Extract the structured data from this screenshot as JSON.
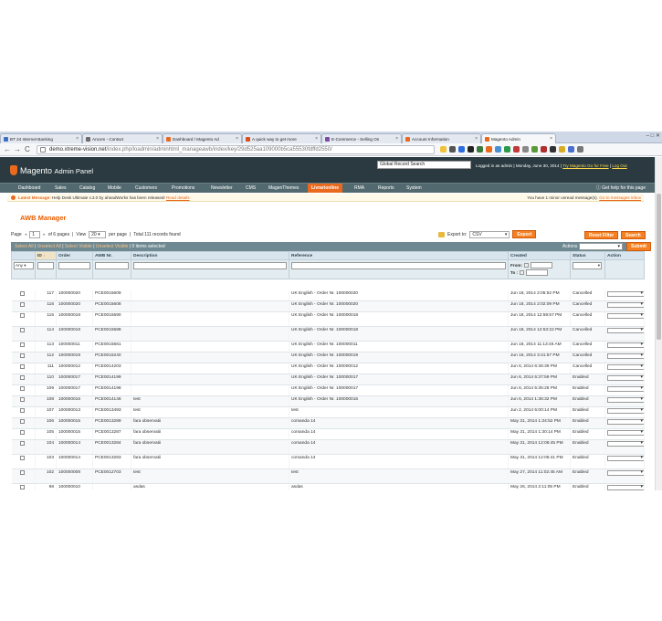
{
  "browser": {
    "tabs": [
      {
        "title": "BT 24 Internet Banking",
        "color": "#3a6fc4"
      },
      {
        "title": "Ancom - Contact",
        "color": "#6c6c6c"
      },
      {
        "title": "Dashboard / Magento Ad",
        "color": "#e96a1f"
      },
      {
        "title": "A quick way to get more",
        "color": "#d9501d"
      },
      {
        "title": "E-Commerce - Selling On",
        "color": "#7a4fa0"
      },
      {
        "title": "Account Information",
        "color": "#e96a1f"
      },
      {
        "title": "Magento Admin",
        "color": "#e96a1f"
      }
    ],
    "url_domain": "demo.xtreme-vision.net",
    "url_path": "/index.php/loadmin/adminhtml_manageawb/index/key/29d525aa109000b5ca55530fdffd2550/"
  },
  "header": {
    "logo": "Magento",
    "logo_sub": "Admin Panel",
    "search_value": "Global Record Search",
    "logged_in": "Logged in as admin",
    "date": "Monday, June 30, 2014",
    "try_link": "Try Magento Go for Free",
    "logout": "Log Out"
  },
  "nav": {
    "items": [
      "Dashboard",
      "Sales",
      "Catalog",
      "Mobile",
      "Customers",
      "Promotions",
      "Newsletter",
      "CMS",
      "MagenThemes",
      "Livrarionline",
      "RMA",
      "Reports",
      "System"
    ],
    "active": "Livrarionline",
    "help": "Get help for this page"
  },
  "notice": {
    "label": "Latest Message:",
    "text": "Help Desk Ultimate v.3.0 by aheadWorks has been released!",
    "read_details": "Read details",
    "right_text": "You have 1 minor unread message(s).",
    "go_link": "Go to messages inbox"
  },
  "page": {
    "title": "AWB Manager",
    "page_label": "Page",
    "page_value": "1",
    "of_pages": "of 6 pages",
    "view_label": "View",
    "view_value": "20",
    "per_page": "per page",
    "total": "Total 111 records found",
    "export_label": "Export to:",
    "export_value": "CSV",
    "export_btn": "Export",
    "reset_btn": "Reset Filter",
    "search_btn": "Search"
  },
  "massaction": {
    "select_all": "Select All",
    "unselect_all": "Unselect All",
    "select_visible": "Select Visible",
    "unselect_visible": "Unselect Visible",
    "selected": "0 items selected",
    "actions_label": "Actions",
    "submit": "Submit"
  },
  "grid": {
    "columns": [
      "",
      "ID",
      "Order",
      "AWB Nr.",
      "Description",
      "Reference",
      "Created",
      "Status",
      "Action"
    ],
    "filter_any": "Any",
    "filter_from": "From:",
    "filter_to": "To :",
    "rows": [
      {
        "id": "117",
        "order": "100000020",
        "awb": "PCE0015609",
        "desc": "",
        "ref": "UK English - Order Nr. 100000020",
        "created": "Jun 18, 2014 2:05:52 PM",
        "status": "Cancelled"
      },
      {
        "id": "116",
        "order": "100000020",
        "awb": "PCE0015608",
        "desc": "",
        "ref": "UK English - Order Nr. 100000020",
        "created": "Jun 18, 2014 2:02:09 PM",
        "status": "Cancelled"
      },
      {
        "id": "115",
        "order": "100000018",
        "awb": "PCE0015590",
        "desc": "",
        "ref": "UK English - Order Nr. 100000018",
        "created": "Jun 18, 2014 12:59:57 PM",
        "status": "Cancelled"
      },
      {
        "id": "114",
        "order": "100000018",
        "awb": "PCE0015588",
        "desc": "",
        "ref": "UK English - Order Nr. 100000018",
        "created": "Jun 18, 2014 12:53:22 PM",
        "status": "Cancelled"
      },
      {
        "id": "113",
        "order": "100000011",
        "awb": "PCE0015561",
        "desc": "",
        "ref": "UK English - Order Nr. 100000011",
        "created": "Jun 18, 2014 11:13:46 AM",
        "status": "Cancelled"
      },
      {
        "id": "112",
        "order": "100000019",
        "awb": "PCE0015240",
        "desc": "",
        "ref": "UK English - Order Nr. 100000019",
        "created": "Jun 16, 2014 3:41:57 PM",
        "status": "Cancelled"
      },
      {
        "id": "111",
        "order": "100000012",
        "awb": "PCE0014203",
        "desc": "",
        "ref": "UK English - Order Nr. 100000012",
        "created": "Jun 6, 2014 6:36:39 PM",
        "status": "Cancelled"
      },
      {
        "id": "110",
        "order": "100000017",
        "awb": "PCE0014199",
        "desc": "",
        "ref": "UK English - Order Nr. 100000017",
        "created": "Jun 6, 2014 5:37:59 PM",
        "status": "Enabled"
      },
      {
        "id": "109",
        "order": "100000017",
        "awb": "PCE0014198",
        "desc": "",
        "ref": "UK English - Order Nr. 100000017",
        "created": "Jun 6, 2014 5:35:28 PM",
        "status": "Enabled"
      },
      {
        "id": "108",
        "order": "100000016",
        "awb": "PCE0014146",
        "desc": "test",
        "ref": "UK English - Order Nr. 100000016",
        "created": "Jun 6, 2014 1:36:32 PM",
        "status": "Enabled"
      },
      {
        "id": "107",
        "order": "100000013",
        "awb": "PCE0013493",
        "desc": "test",
        "ref": "test",
        "created": "Jun 2, 2014 5:00:14 PM",
        "status": "Enabled"
      },
      {
        "id": "106",
        "order": "100000015",
        "awb": "PCE0013289",
        "desc": "fara observatii",
        "ref": "comanda 14",
        "created": "May 31, 2014 1:34:52 PM",
        "status": "Enabled"
      },
      {
        "id": "105",
        "order": "100000015",
        "awb": "PCE0013287",
        "desc": "fara observatii",
        "ref": "comanda 14",
        "created": "May 31, 2014 1:30:14 PM",
        "status": "Enabled"
      },
      {
        "id": "104",
        "order": "100000014",
        "awb": "PCE0013284",
        "desc": "fara observatii",
        "ref": "comanda 14",
        "created": "May 31, 2014 12:06:45 PM",
        "status": "Enabled"
      },
      {
        "id": "103",
        "order": "100000014",
        "awb": "PCE0013283",
        "desc": "fara observatii",
        "ref": "comanda 14",
        "created": "May 31, 2014 12:05:41 PM",
        "status": "Enabled"
      },
      {
        "id": "102",
        "order": "100000008",
        "awb": "PCE0012703",
        "desc": "test",
        "ref": "test",
        "created": "May 27, 2014 11:02:45 AM",
        "status": "Enabled"
      },
      {
        "id": "98",
        "order": "100000010",
        "awb": "",
        "desc": "asdas",
        "ref": "asdas",
        "created": "May 26, 2014 2:11:05 PM",
        "status": "Enabled"
      }
    ]
  }
}
